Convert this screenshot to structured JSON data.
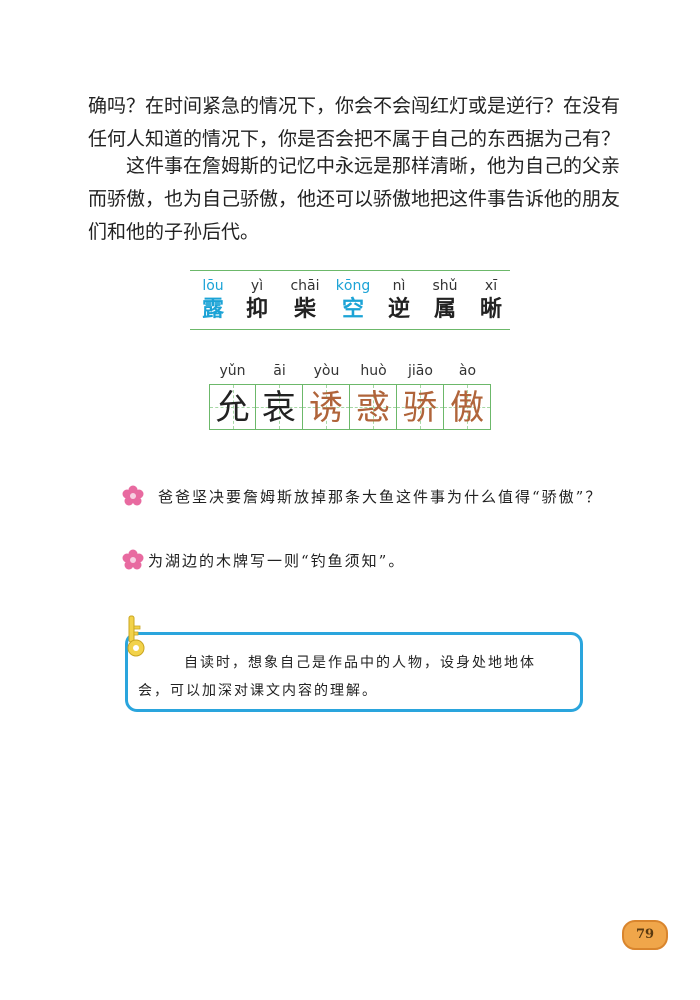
{
  "paragraphs": {
    "p1": "确吗？在时间紧急的情况下，你会不会闯红灯或是逆行？在没有任何人知道的情况下，你是否会把不属于自己的东西据为己有？",
    "p2": "这件事在詹姆斯的记忆中永远是那样清晰，他为自己的父亲而骄傲，也为自己骄傲，他还可以骄傲地把这件事告诉他的朋友们和他的子孙后代。"
  },
  "recognize_words": [
    {
      "pinyin": "lōu",
      "hanzi": "露",
      "color": "#1ca3d6"
    },
    {
      "pinyin": "yì",
      "hanzi": "抑",
      "color": "#222222"
    },
    {
      "pinyin": "chāi",
      "hanzi": "柴",
      "color": "#222222"
    },
    {
      "pinyin": "kōng",
      "hanzi": "空",
      "color": "#1ca3d6"
    },
    {
      "pinyin": "nì",
      "hanzi": "逆",
      "color": "#222222"
    },
    {
      "pinyin": "shǔ",
      "hanzi": "属",
      "color": "#222222"
    },
    {
      "pinyin": "xī",
      "hanzi": "晰",
      "color": "#222222"
    }
  ],
  "write_words": [
    {
      "pinyin": "yǔn",
      "hanzi": "允",
      "color": "#222222"
    },
    {
      "pinyin": "āi",
      "hanzi": "哀",
      "color": "#222222"
    },
    {
      "pinyin": "yòu",
      "hanzi": "诱",
      "color": "#b0643a"
    },
    {
      "pinyin": "huò",
      "hanzi": "惑",
      "color": "#b0643a"
    },
    {
      "pinyin": "jiāo",
      "hanzi": "骄",
      "color": "#b0643a"
    },
    {
      "pinyin": "ào",
      "hanzi": "傲",
      "color": "#b0643a"
    }
  ],
  "questions": {
    "q1": "爸爸坚决要詹姆斯放掉那条大鱼这件事为什么值得“骄傲”？",
    "q2": "为湖边的木牌写一则“钓鱼须知”。"
  },
  "tip": {
    "line1": "自读时，想象自己是作品中的人物，设身处地地体",
    "line2": "会，可以加深对课文内容的理解。"
  },
  "page_number": "79",
  "icons": {
    "flower": "flower-icon",
    "key": "key-icon"
  },
  "colors": {
    "accent_blue": "#2aa5dd",
    "grid_green": "#6cb86a",
    "highlight_brown": "#b0643a"
  }
}
